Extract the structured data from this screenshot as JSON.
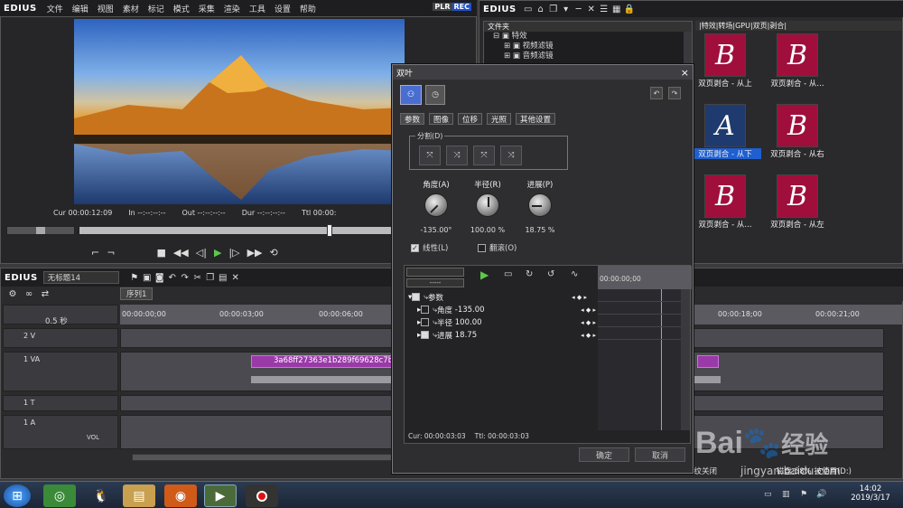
{
  "app_name": "EDIUS",
  "menu": [
    "文件",
    "编辑",
    "视图",
    "素材",
    "标记",
    "模式",
    "采集",
    "渲染",
    "工具",
    "设置",
    "帮助"
  ],
  "plr": {
    "plr": "PLR",
    "rec": "REC"
  },
  "player": {
    "cur": "Cur 00:00:12:09",
    "in": "In --:--:--:--",
    "out": "Out --:--:--:--",
    "dur": "Dur --:--:--:--",
    "ttl": "Ttl 00:00:"
  },
  "bin": {
    "app": "EDIUS",
    "folder_header": "文件夹",
    "tree": [
      "特效",
      "视频滤镜",
      "音频滤镜"
    ],
    "path": "|特效|转场|GPU|双页|剥合|"
  },
  "thumbs": [
    {
      "letter": "B",
      "label": "双页剥合 - 从上"
    },
    {
      "letter": "B",
      "label": "双页剥合 - 从..."
    },
    {
      "letter": "A",
      "label": "双页剥合 - 从下"
    },
    {
      "letter": "B",
      "label": "双页剥合 - 从右"
    },
    {
      "letter": "B",
      "label": "双页剥合 - 从..."
    },
    {
      "letter": "B",
      "label": "双页剥合 - 从左"
    }
  ],
  "timeline": {
    "app": "EDIUS",
    "project": "无标题14",
    "sequence": "序列1",
    "zoom": "0.5 秒",
    "ruler": [
      "00:00:00;00",
      "00:00:03;00",
      "00:00:06;00",
      "00:00:18;00",
      "00:00:21;00"
    ],
    "tracks": [
      {
        "name": "2 V"
      },
      {
        "name": "1 VA"
      },
      {
        "name": "1 T"
      },
      {
        "name": "1 A"
      }
    ],
    "clip_name": "3a68ff27363e1b289f69628c7b7f",
    "vol": "VOL"
  },
  "dialog": {
    "title": "双叶",
    "close": "×",
    "tabs": [
      "参数",
      "图像",
      "位移",
      "光照",
      "其他设置"
    ],
    "split_group": "分割(D)",
    "knobs": [
      {
        "label": "角度(A)",
        "value": "-135.00°"
      },
      {
        "label": "半径(R)",
        "value": "100.00 %"
      },
      {
        "label": "进展(P)",
        "value": "18.75 %"
      }
    ],
    "linear": "线性(L)",
    "reverse": "翻滚(O)",
    "keyframe_dropdown": "-----",
    "tree": [
      {
        "label": "参数",
        "value": ""
      },
      {
        "label": "角度",
        "value": "-135.00"
      },
      {
        "label": "半径",
        "value": "100.00"
      },
      {
        "label": "进展",
        "value": "18.75"
      }
    ],
    "kf_time": "00:00:00;00",
    "cur": "Cur: 00:00:03:03",
    "ttl": "Ttl: 00:00:03:03",
    "ok": "确定",
    "cancel": "取消"
  },
  "status": {
    "text": "波纹关闭",
    "disk": "磁盘:58% 被使用(D:)"
  },
  "tray": {
    "time": "14:02",
    "date": "2019/3/17"
  },
  "watermark": {
    "brand": "Bai",
    "brand2": "经验",
    "url": "jingyan.baidu.com"
  }
}
